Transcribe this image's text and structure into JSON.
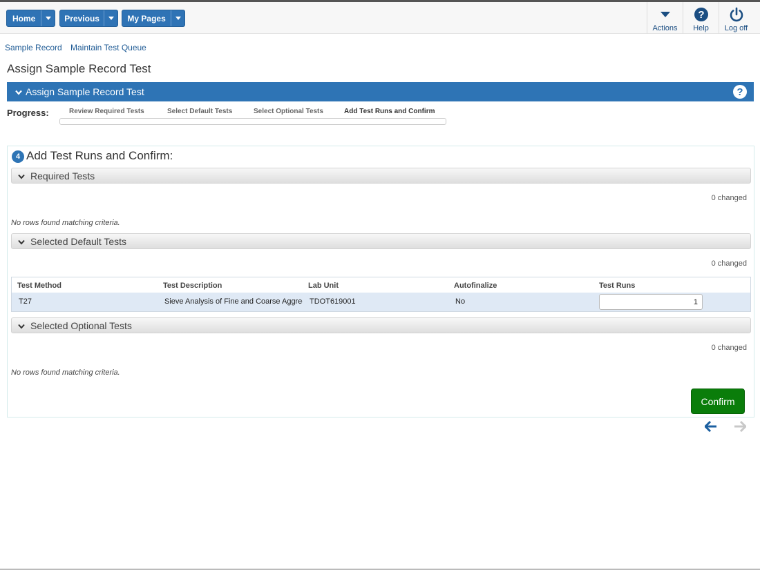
{
  "nav": {
    "home": "Home",
    "previous": "Previous",
    "my_pages": "My Pages"
  },
  "toolbar": {
    "actions": "Actions",
    "help": "Help",
    "logoff": "Log off"
  },
  "breadcrumb": [
    "Sample Record",
    "Maintain Test Queue"
  ],
  "page_title": "Assign Sample Record Test",
  "panel_title": "Assign Sample Record Test",
  "progress": {
    "label": "Progress:",
    "steps": [
      "Review Required Tests",
      "Select Default Tests",
      "Select Optional Tests",
      "Add Test Runs and Confirm"
    ],
    "active_step": 4
  },
  "step": {
    "number": "4",
    "title": "Add Test Runs and Confirm:"
  },
  "sections": {
    "required": {
      "title": "Required Tests",
      "changed": "0 changed",
      "empty": "No rows found matching criteria."
    },
    "default": {
      "title": "Selected Default Tests",
      "changed": "0 changed",
      "columns": [
        "Test Method",
        "Test Description",
        "Lab Unit",
        "Autofinalize",
        "Test Runs"
      ],
      "rows": [
        {
          "method": "T27",
          "description": "Sieve Analysis of Fine and Coarse Aggregates",
          "lab_unit": "TDOT619001",
          "autofinalize": "No",
          "test_runs": "1"
        }
      ]
    },
    "optional": {
      "title": "Selected Optional Tests",
      "changed": "0 changed",
      "empty": "No rows found matching criteria."
    }
  },
  "confirm_label": "Confirm",
  "colors": {
    "primary": "#2e74b5",
    "confirm": "#0a7d0a"
  }
}
